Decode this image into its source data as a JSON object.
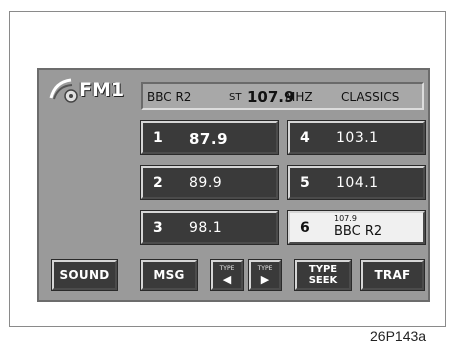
{
  "header": {
    "band": "FM1",
    "station_name": "BBC R2",
    "stereo": "ST",
    "frequency": "107.9",
    "unit": "MHZ",
    "genre": "CLASSICS",
    "logo_icon": "radio-antenna-icon"
  },
  "presets": [
    {
      "number": "1",
      "frequency": "87.9"
    },
    {
      "number": "2",
      "frequency": "89.9"
    },
    {
      "number": "3",
      "frequency": "98.1"
    },
    {
      "number": "4",
      "frequency": "103.1"
    },
    {
      "number": "5",
      "frequency": "104.1"
    },
    {
      "number": "6",
      "small_frequency": "107.9",
      "station": "BBC R2"
    }
  ],
  "buttons": {
    "sound": "SOUND",
    "msg": "MSG",
    "type_prev_top": "TYPE",
    "type_prev_arrow": "◀",
    "type_next_top": "TYPE",
    "type_next_arrow": "▶",
    "type_seek_line1": "TYPE",
    "type_seek_line2": "SEEK",
    "traf": "TRAF"
  },
  "caption": "26P143a"
}
